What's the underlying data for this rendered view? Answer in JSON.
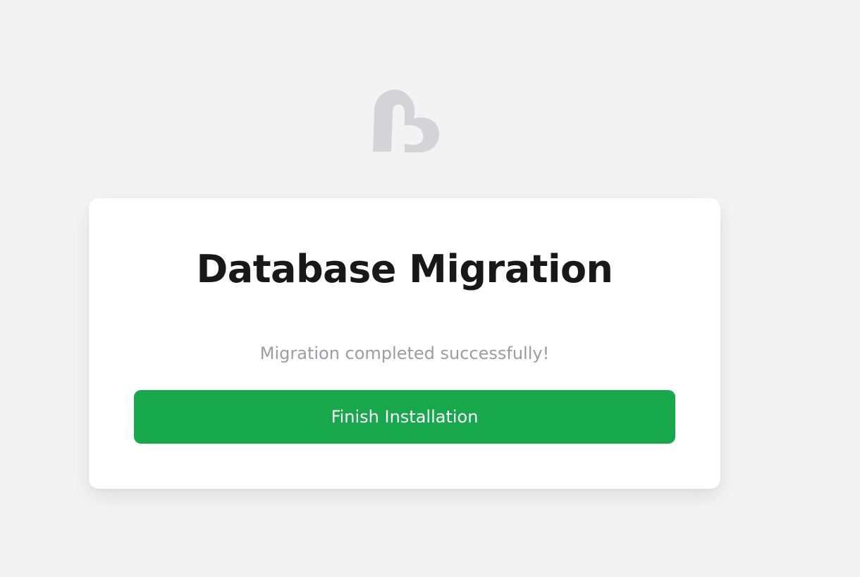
{
  "logo": {
    "icon": "brand-logo-icon",
    "color": "#d4d4d8"
  },
  "card": {
    "title": "Database Migration",
    "status_message": "Migration completed successfully!",
    "finish_button_label": "Finish Installation"
  },
  "colors": {
    "background": "#f3f3f3",
    "card": "#ffffff",
    "button": "#16a84b",
    "title_text": "#18181b",
    "muted_text": "#9c9ca3"
  }
}
